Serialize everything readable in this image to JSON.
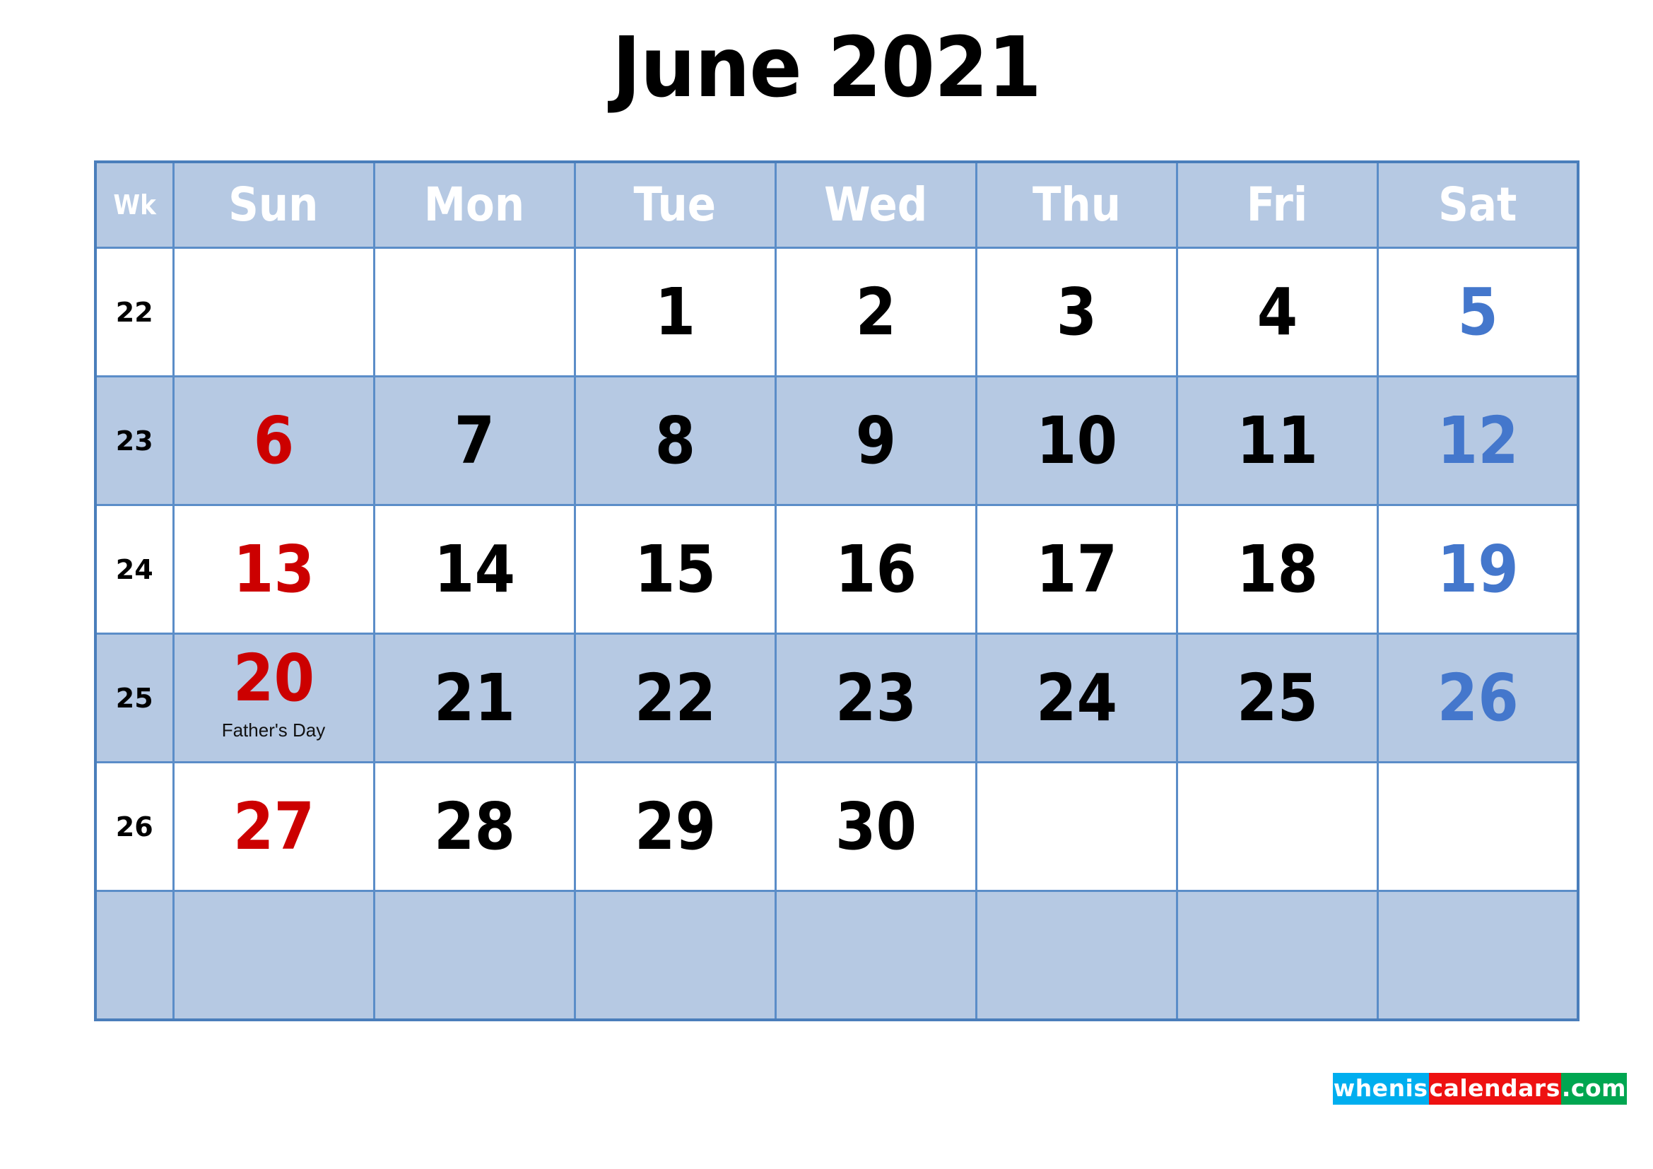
{
  "title": "June 2021",
  "colors": {
    "header_bg": "#b6c9e3",
    "grid_border": "#5b8dc8",
    "outer_border": "#4a7ebb",
    "row_shade": "#b6c9e3",
    "sunday_text": "#cc0000",
    "saturday_text": "#4477cc",
    "weekday_text": "#000000",
    "header_text": "#ffffff",
    "watermark_cyan": "#00aeef",
    "watermark_red": "#ee1111",
    "watermark_green": "#00a651"
  },
  "header": {
    "wk_label": "Wk",
    "days": [
      "Sun",
      "Mon",
      "Tue",
      "Wed",
      "Thu",
      "Fri",
      "Sat"
    ]
  },
  "weeks": [
    {
      "wk": "22",
      "days": [
        {
          "num": "",
          "note": ""
        },
        {
          "num": "",
          "note": ""
        },
        {
          "num": "1",
          "note": ""
        },
        {
          "num": "2",
          "note": ""
        },
        {
          "num": "3",
          "note": ""
        },
        {
          "num": "4",
          "note": ""
        },
        {
          "num": "5",
          "note": ""
        }
      ]
    },
    {
      "wk": "23",
      "days": [
        {
          "num": "6",
          "note": ""
        },
        {
          "num": "7",
          "note": ""
        },
        {
          "num": "8",
          "note": ""
        },
        {
          "num": "9",
          "note": ""
        },
        {
          "num": "10",
          "note": ""
        },
        {
          "num": "11",
          "note": ""
        },
        {
          "num": "12",
          "note": ""
        }
      ]
    },
    {
      "wk": "24",
      "days": [
        {
          "num": "13",
          "note": ""
        },
        {
          "num": "14",
          "note": ""
        },
        {
          "num": "15",
          "note": ""
        },
        {
          "num": "16",
          "note": ""
        },
        {
          "num": "17",
          "note": ""
        },
        {
          "num": "18",
          "note": ""
        },
        {
          "num": "19",
          "note": ""
        }
      ]
    },
    {
      "wk": "25",
      "days": [
        {
          "num": "20",
          "note": "Father's Day"
        },
        {
          "num": "21",
          "note": ""
        },
        {
          "num": "22",
          "note": ""
        },
        {
          "num": "23",
          "note": ""
        },
        {
          "num": "24",
          "note": ""
        },
        {
          "num": "25",
          "note": ""
        },
        {
          "num": "26",
          "note": ""
        }
      ]
    },
    {
      "wk": "26",
      "days": [
        {
          "num": "27",
          "note": ""
        },
        {
          "num": "28",
          "note": ""
        },
        {
          "num": "29",
          "note": ""
        },
        {
          "num": "30",
          "note": ""
        },
        {
          "num": "",
          "note": ""
        },
        {
          "num": "",
          "note": ""
        },
        {
          "num": "",
          "note": ""
        }
      ]
    },
    {
      "wk": "",
      "days": [
        {
          "num": "",
          "note": ""
        },
        {
          "num": "",
          "note": ""
        },
        {
          "num": "",
          "note": ""
        },
        {
          "num": "",
          "note": ""
        },
        {
          "num": "",
          "note": ""
        },
        {
          "num": "",
          "note": ""
        },
        {
          "num": "",
          "note": ""
        }
      ]
    }
  ],
  "watermark": {
    "part1": "whenis",
    "part2": "calendars",
    "part3": ".com"
  }
}
